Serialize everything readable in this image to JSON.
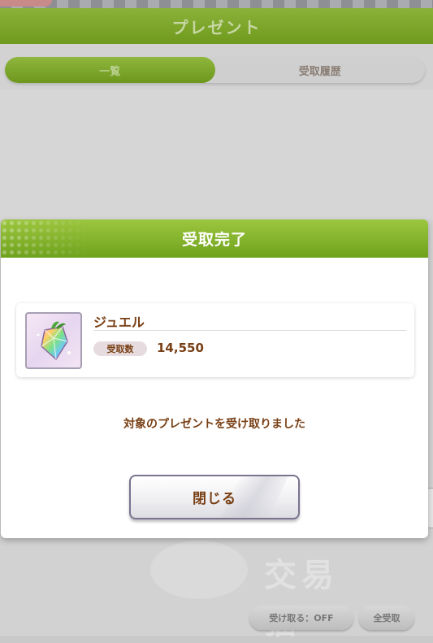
{
  "background": {
    "header_title": "プレゼント",
    "tabs": [
      {
        "label": "一覧",
        "active": true
      },
      {
        "label": "受取履歴",
        "active": false
      }
    ],
    "bottom_buttons": [
      "受け取る：OFF",
      "全受取"
    ],
    "watermark": "交易猫"
  },
  "dialog": {
    "title": "受取完了",
    "item": {
      "name": "ジュエル",
      "quantity_label": "受取数",
      "quantity": "14,550",
      "icon": "jewel-icon"
    },
    "message": "対象のプレゼントを受け取りました",
    "close_label": "閉じる"
  },
  "colors": {
    "header_green": "#7fae2a",
    "text_brown": "#794016",
    "button_border": "#7b7390"
  }
}
